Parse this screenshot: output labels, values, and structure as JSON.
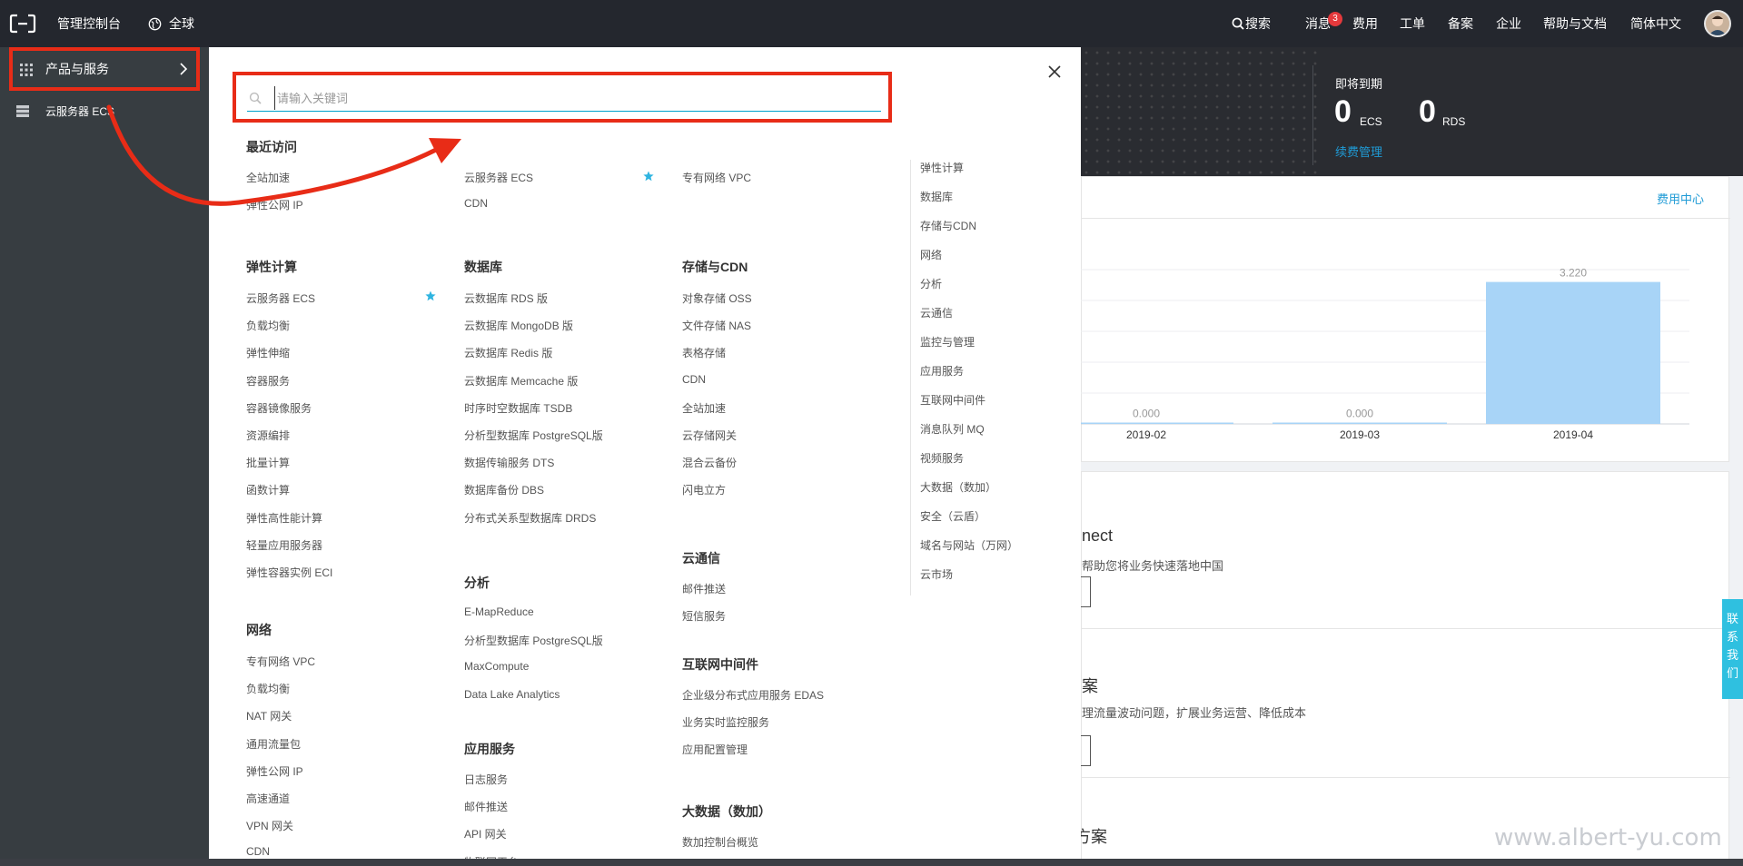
{
  "topbar": {
    "console": "管理控制台",
    "region": "全球",
    "search": "搜索",
    "messages": "消息",
    "badge": "3",
    "billing": "费用",
    "tickets": "工单",
    "icp": "备案",
    "enterprise": "企业",
    "help": "帮助与文档",
    "language": "简体中文"
  },
  "sidebar": {
    "products": "产品与服务",
    "ecs": "云服务器 ECS"
  },
  "panel": {
    "search_placeholder": "请输入关键词",
    "recent": {
      "title": "最近访问",
      "col1": [
        "全站加速",
        "弹性公网 IP"
      ],
      "col2": [
        "云服务器 ECS",
        "CDN"
      ],
      "col3": [
        "专有网络 VPC"
      ]
    },
    "groups": {
      "compute": {
        "title": "弹性计算",
        "items": [
          "云服务器 ECS",
          "负载均衡",
          "弹性伸缩",
          "容器服务",
          "容器镜像服务",
          "资源编排",
          "批量计算",
          "函数计算",
          "弹性高性能计算",
          "轻量应用服务器",
          "弹性容器实例 ECI"
        ]
      },
      "network": {
        "title": "网络",
        "items": [
          "专有网络 VPC",
          "负载均衡",
          "NAT 网关",
          "通用流量包",
          "弹性公网 IP",
          "高速通道",
          "VPN 网关",
          "CDN"
        ]
      },
      "database": {
        "title": "数据库",
        "items": [
          "云数据库 RDS 版",
          "云数据库 MongoDB 版",
          "云数据库 Redis 版",
          "云数据库 Memcache 版",
          "时序时空数据库 TSDB",
          "分析型数据库 PostgreSQL版",
          "数据传输服务 DTS",
          "数据库备份 DBS",
          "分布式关系型数据库 DRDS"
        ]
      },
      "analytics": {
        "title": "分析",
        "items": [
          "E-MapReduce",
          "分析型数据库 PostgreSQL版",
          "MaxCompute",
          "Data Lake Analytics"
        ]
      },
      "appservice": {
        "title": "应用服务",
        "items": [
          "日志服务",
          "邮件推送",
          "API 网关",
          "物联网平台"
        ]
      },
      "storage": {
        "title": "存储与CDN",
        "items": [
          "对象存储 OSS",
          "文件存储 NAS",
          "表格存储",
          "CDN",
          "全站加速",
          "云存储网关",
          "混合云备份",
          "闪电立方"
        ]
      },
      "comm": {
        "title": "云通信",
        "items": [
          "邮件推送",
          "短信服务"
        ]
      },
      "middleware": {
        "title": "互联网中间件",
        "items": [
          "企业级分布式应用服务 EDAS",
          "业务实时监控服务",
          "应用配置管理"
        ]
      },
      "bigdata": {
        "title": "大数据（数加）",
        "items": [
          "数加控制台概览"
        ]
      }
    },
    "categories": [
      "弹性计算",
      "数据库",
      "存储与CDN",
      "网络",
      "分析",
      "云通信",
      "监控与管理",
      "应用服务",
      "互联网中间件",
      "消息队列 MQ",
      "视频服务",
      "大数据（数加）",
      "安全（云盾）",
      "域名与网站（万网）",
      "云市场"
    ]
  },
  "dashboard": {
    "expiring": "即将到期",
    "ecs_count": "0",
    "ecs_unit": "ECS",
    "rds_count": "0",
    "rds_unit": "RDS",
    "renew": "续费管理",
    "billing_center": "费用中心",
    "sec1_title": "nect",
    "sec1_desc": "帮助您将业务快速落地中国",
    "sec2_title": "案",
    "sec2_desc": "理流量波动问题，扩展业务运营、降低成本",
    "sec3_title": "方案",
    "contact": [
      "联",
      "系",
      "我",
      "们"
    ],
    "watermark": "www.albert-yu.com"
  },
  "chart_data": {
    "type": "bar",
    "categories": [
      "2019-02",
      "2019-03",
      "2019-04"
    ],
    "values": [
      0.0,
      0.0,
      3.22
    ],
    "labels": [
      "0.000",
      "0.000",
      "3.220"
    ],
    "ylim": [
      0,
      3.5
    ],
    "color": "#a8d4f7"
  }
}
